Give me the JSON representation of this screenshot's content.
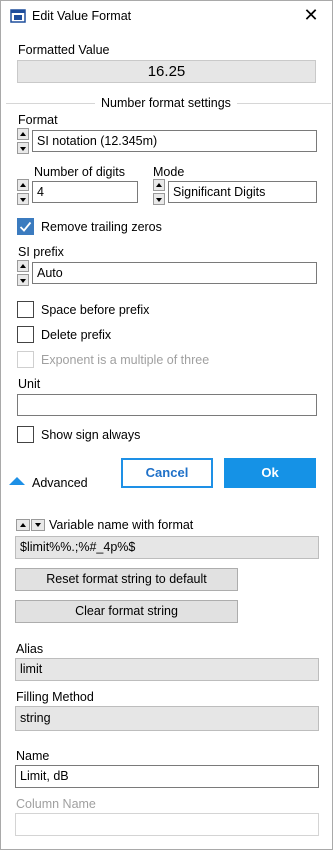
{
  "window": {
    "title": "Edit Value Format",
    "close_glyph": "✕"
  },
  "formatted_value": {
    "label": "Formatted Value",
    "value": "16.25"
  },
  "number_format": {
    "section_title": "Number format settings",
    "format_label": "Format",
    "format_value": "SI notation (12.345m)",
    "digits_label": "Number of digits",
    "digits_value": "4",
    "mode_label": "Mode",
    "mode_value": "Significant Digits",
    "remove_trailing_zeros": {
      "label": "Remove trailing zeros",
      "checked": true
    },
    "si_prefix_label": "SI prefix",
    "si_prefix_value": "Auto",
    "space_before_prefix": {
      "label": "Space before prefix",
      "checked": false
    },
    "delete_prefix": {
      "label": "Delete prefix",
      "checked": false
    },
    "exponent_multiple_three": {
      "label": "Exponent is a multiple of three",
      "checked": false,
      "enabled": false
    },
    "unit_label": "Unit",
    "unit_value": "",
    "show_sign_always": {
      "label": "Show sign always",
      "checked": false
    }
  },
  "actions": {
    "advanced_label": "Advanced",
    "cancel_label": "Cancel",
    "ok_label": "Ok"
  },
  "advanced": {
    "variable_label": "Variable name with format",
    "variable_value": "$limit%%.;%#_4p%$",
    "reset_button": "Reset format string to default",
    "clear_button": "Clear format string",
    "alias_label": "Alias",
    "alias_value": "limit",
    "filling_label": "Filling Method",
    "filling_value": "string",
    "name_label": "Name",
    "name_value": "Limit, dB",
    "column_label": "Column Name",
    "column_value": ""
  },
  "colors": {
    "accent": "#1592e6",
    "checkbox_checked": "#3b7bbf",
    "readonly_bg": "#e6e6e6"
  }
}
